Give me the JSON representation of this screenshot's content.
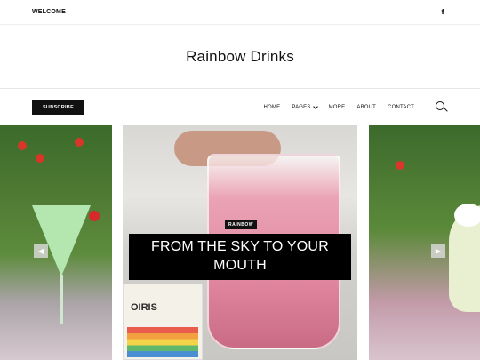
{
  "topbar": {
    "welcome": "WELCOME",
    "facebook_icon": "f"
  },
  "brand": {
    "title": "Rainbow Drinks"
  },
  "nav": {
    "subscribe_label": "SUBSCRIBE",
    "items": [
      "HOME",
      "PAGES",
      "MORE",
      "ABOUT",
      "CONTACT"
    ]
  },
  "slider": {
    "featured": {
      "category": "RAINBOW",
      "title": "FROM THE SKY TO YOUR MOUTH"
    },
    "prev_icon": "chevron-left-icon",
    "next_icon": "chevron-right-icon",
    "sign_text": "OIRIS"
  }
}
